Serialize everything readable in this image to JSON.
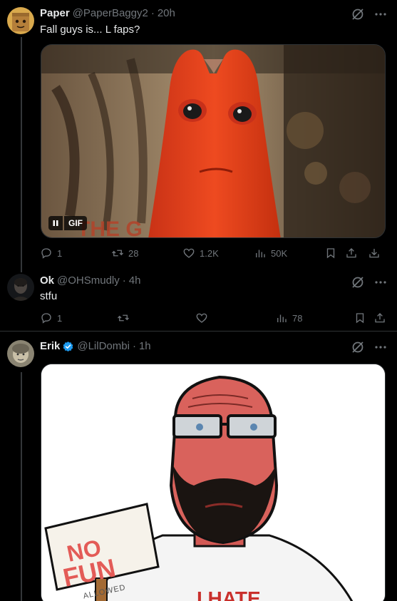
{
  "tweets": [
    {
      "name": "Paper",
      "handle": "@PaperBaggy2",
      "time": "20h",
      "text": "Fall guys is... L faps?",
      "media": {
        "kind": "gif",
        "badge": "GIF",
        "caption_fragment": "THE G"
      },
      "stats": {
        "replies": "1",
        "retweets": "28",
        "likes": "1.2K",
        "views": "50K"
      }
    },
    {
      "name": "Ok",
      "handle": "@OHSmudly",
      "time": "4h",
      "text": "stfu",
      "stats": {
        "replies": "1",
        "retweets": "",
        "likes": "",
        "views": "78"
      }
    },
    {
      "name": "Erik",
      "handle": "@LilDombi",
      "time": "1h",
      "verified": true,
      "media": {
        "kind": "image",
        "sign_line1": "NO",
        "sign_line2": "FUN",
        "sign_line3": "ALLOWED",
        "shirt_text": "I HATE"
      }
    }
  ],
  "separator": "·",
  "colors": {
    "background": "#000000",
    "muted": "#71767b",
    "text": "#e7e9ea",
    "verified": "#1d9bf0",
    "divider": "#2f3336"
  }
}
